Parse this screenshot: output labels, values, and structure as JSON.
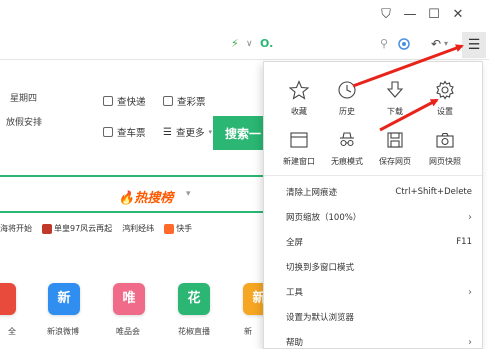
{
  "titlebar": {
    "controls": [
      "shirt-icon",
      "minimize-icon",
      "maximize-icon",
      "close-icon"
    ],
    "control_glyphs": [
      "⛉",
      "—",
      "☐",
      "✕"
    ]
  },
  "addressbar": {
    "icons": [
      "lightning-icon",
      "chevron-down-icon",
      "search-engine-icon",
      "search-icon",
      "sync-icon",
      "undo-icon",
      "menu-icon"
    ]
  },
  "page": {
    "weekday": "星期四",
    "holiday": "放假安排",
    "quick_links": [
      "查快递",
      "查彩票",
      "查车票",
      "查更多"
    ],
    "hot_search": "热搜榜",
    "search_button": "搜索一",
    "news": [
      "海将开始",
      "单皇97风云再起",
      "鸿利经纬",
      "快手"
    ],
    "apps": [
      {
        "glyph": "",
        "label": "全",
        "color": "#e84a3c"
      },
      {
        "glyph": "新",
        "label": "新浪微博",
        "color": "#2f8ef0"
      },
      {
        "glyph": "唯",
        "label": "唯品会",
        "color": "#f06a8a"
      },
      {
        "glyph": "花",
        "label": "花椒直播",
        "color": "#2bb673"
      },
      {
        "glyph": "新",
        "label": "新",
        "color": "#f5a623"
      }
    ]
  },
  "menu": {
    "tiles_row1": [
      {
        "icon": "star-icon",
        "label": "收藏"
      },
      {
        "icon": "history-clock-icon",
        "label": "历史"
      },
      {
        "icon": "download-icon",
        "label": "下载"
      },
      {
        "icon": "gear-icon",
        "label": "设置"
      }
    ],
    "tiles_row2": [
      {
        "icon": "new-window-icon",
        "label": "新建窗口"
      },
      {
        "icon": "incognito-icon",
        "label": "无痕模式"
      },
      {
        "icon": "save-page-icon",
        "label": "保存网页"
      },
      {
        "icon": "camera-icon",
        "label": "网页快照"
      }
    ],
    "items": [
      {
        "label": "清除上网痕迹",
        "shortcut": "Ctrl+Shift+Delete",
        "arrow": ""
      },
      {
        "label": "网页缩放（100%）",
        "shortcut": "",
        "arrow": "›"
      },
      {
        "label": "全屏",
        "shortcut": "F11",
        "arrow": ""
      },
      {
        "label": "切换到多窗口模式",
        "shortcut": "",
        "arrow": ""
      },
      {
        "label": "工具",
        "shortcut": "",
        "arrow": "›"
      },
      {
        "label": "设置为默认浏览器",
        "shortcut": "",
        "arrow": ""
      },
      {
        "label": "帮助",
        "shortcut": "",
        "arrow": "›"
      }
    ]
  },
  "colors": {
    "accent_green": "#2bb673",
    "hot_orange": "#ff5a00",
    "annotation_red": "#e8231a"
  }
}
